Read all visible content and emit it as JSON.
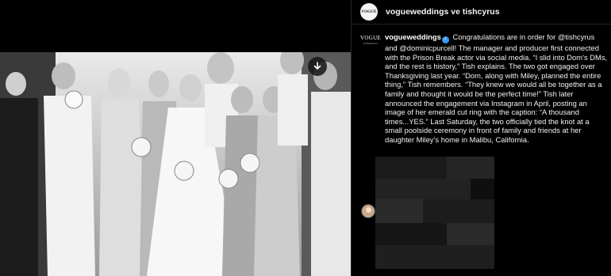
{
  "header": {
    "avatar_text": "VOGUE",
    "title": "vogueweddings ve tishcyrus"
  },
  "caption": {
    "avatar_text": "VOGUE",
    "avatar_sub": "WEDDINGS",
    "username": "vogueweddings",
    "text": "Congratulations are in order for @tishcyrus and @dominicpurcell! The manager and producer first connected with the Prison Break actor via social media. “I slid into Dom’s DMs, and the rest is history,” Tish explains. The two got engaged over Thanksgiving last year. “Dom, along with Miley, planned the entire thing,” Tish remembers. “They knew we would all be together as a family and thought it would be the perfect time!” Tish later announced the engagement via Instagram in April, posting an image of her emerald cut ring with the caption: “A thousand times...YES.” Last Saturday, the two officially tied the knot at a small poolside ceremony in front of family and friends at her daughter Miley’s home in Malibu, California."
  },
  "icons": {
    "verified": "verified-badge-icon",
    "download": "download-arrow-icon"
  },
  "colors": {
    "background": "#000000",
    "verified": "#3897f0",
    "text": "#f0f0f0"
  }
}
